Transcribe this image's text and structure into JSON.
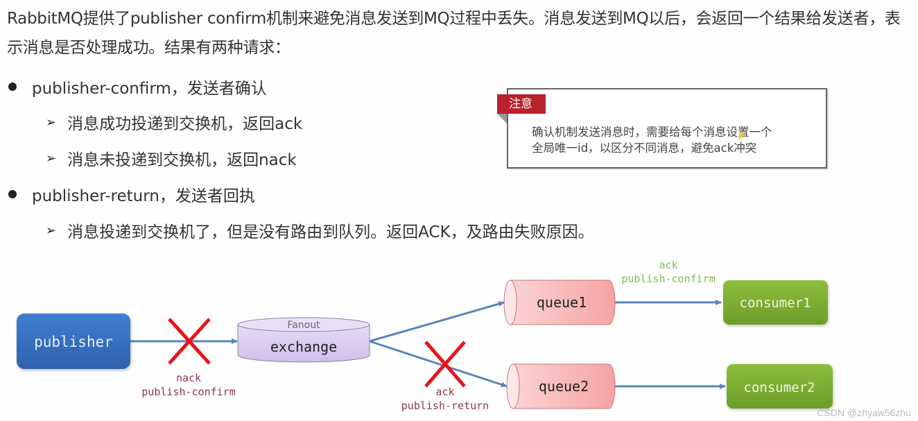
{
  "intro_text": "RabbitMQ提供了publisher confirm机制来避免消息发送到MQ过程中丢失。消息发送到MQ以后，会返回一个结果给发送者，表示消息是否处理成功。结果有两种请求：",
  "bullets": [
    {
      "label": "publisher-confirm，发送者确认",
      "sub_items": [
        "消息成功投递到交换机，返回ack",
        "消息未投递到交换机，返回nack"
      ]
    },
    {
      "label": "publisher-return，发送者回执",
      "sub_items": [
        "消息投递到交换机了，但是没有路由到队列。返回ACK，及路由失败原因。"
      ]
    }
  ],
  "note": {
    "tag": "注意",
    "lines": [
      "确认机制发送消息时，需要给每个消息设置一个",
      "全局唯一id，以区分不同消息，避免ack冲突"
    ]
  },
  "diagram": {
    "publisher": "publisher",
    "exchange_type": "Fanout",
    "exchange": "exchange",
    "queue1": "queue1",
    "queue2": "queue2",
    "consumer1": "consumer1",
    "consumer2": "consumer2",
    "label_nack_1": "nack",
    "label_nack_2": "publish-confirm",
    "label_ack_confirm_1": "ack",
    "label_ack_confirm_2": "publish-confirm",
    "label_ack_return_1": "ack",
    "label_ack_return_2": "publish-return",
    "colors": {
      "publisher": "#3a73c4",
      "exchange": "#d9cdef",
      "queue": "#f7b5b5",
      "consumer": "#7fae32",
      "arrow": "#5b84bd",
      "cross": "#e8121b",
      "fail_label": "#8a3a4a",
      "ok_label": "#7cbf4a"
    }
  },
  "watermark": "CSDN @zhyaw56zhu"
}
